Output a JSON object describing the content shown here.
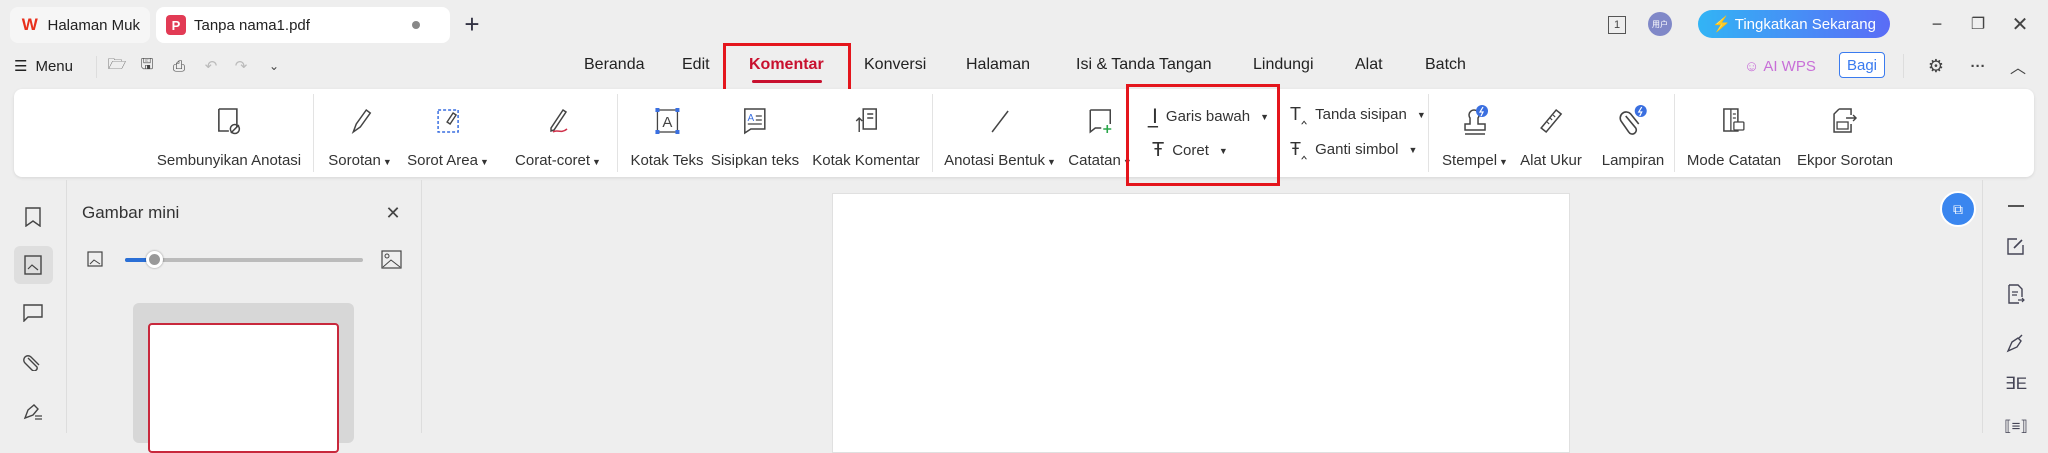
{
  "tabs": [
    {
      "label": "Halaman Muka",
      "logo": "W"
    },
    {
      "label": "Tanpa nama1.pdf",
      "logo": "P"
    }
  ],
  "title_bar": {
    "page_badge": "1",
    "avatar_text": "用户",
    "upgrade_label": "Tingkatkan Sekarang"
  },
  "menu": {
    "label": "Menu"
  },
  "nav_tabs": [
    "Beranda",
    "Edit",
    "Komentar",
    "Konversi",
    "Halaman",
    "Isi & Tanda Tangan",
    "Lindungi",
    "Alat",
    "Batch"
  ],
  "active_tab": "Komentar",
  "right_toolbar": {
    "ai_label": "AI WPS",
    "share_label": "Bagi"
  },
  "ribbon": {
    "hide": "Sembunyikan Anotasi",
    "highlight": "Sorotan",
    "area_highlight": "Sorot Area",
    "scribble": "Corat-coret",
    "textbox": "Kotak Teks",
    "insert_text": "Sisipkan teks",
    "comment_box": "Kotak Komentar",
    "shape": "Anotasi Bentuk",
    "note": "Catatan",
    "underline": "Garis bawah",
    "strike": "Coret",
    "caret": "Tanda sisipan",
    "replace": "Ganti simbol",
    "stamp": "Stempel",
    "measure": "Alat Ukur",
    "attach": "Lampiran",
    "note_mode": "Mode Catatan",
    "export": "Ekpor Sorotan"
  },
  "side_panel": {
    "title": "Gambar mini",
    "zoom_level": 0.12
  },
  "colors": {
    "accent": "#c8102e",
    "highlight_box": "#e4151c",
    "blue": "#3a86ef"
  }
}
